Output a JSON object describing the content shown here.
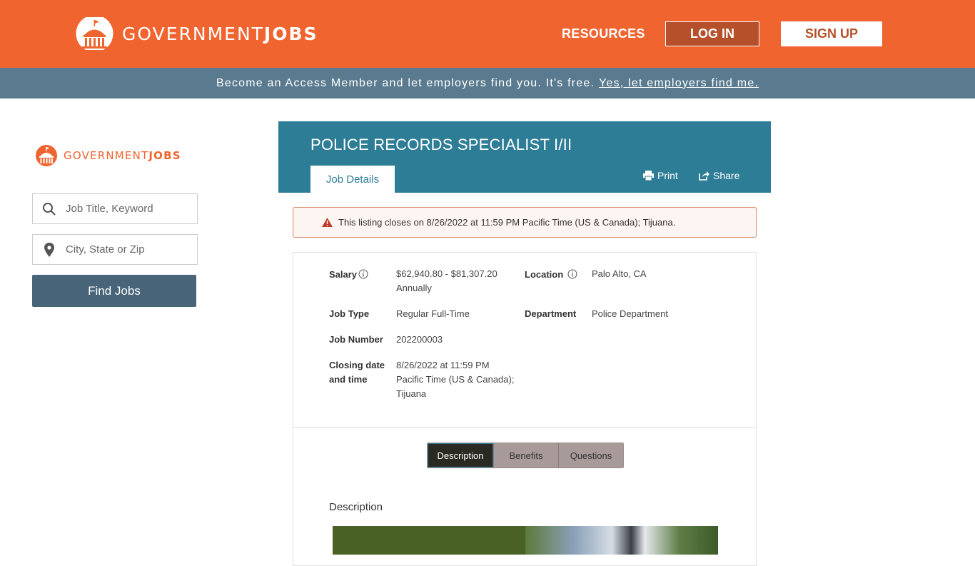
{
  "header": {
    "brand_main": "GOVERNMENT",
    "brand_bold": "JOBS",
    "resources": "RESOURCES",
    "login": "LOG IN",
    "signup": "SIGN UP",
    "color": "#f0642f"
  },
  "access_bar": {
    "text": "Become an Access Member and let employers find you. It's free.",
    "link": "Yes, let employers find me."
  },
  "sidebar": {
    "brand_main": "GOVERNMENT",
    "brand_bold": "JOBS",
    "keyword_placeholder": "Job Title, Keyword",
    "location_placeholder": "City, State or Zip",
    "find_button": "Find Jobs"
  },
  "job": {
    "title": "POLICE RECORDS SPECIALIST I/II",
    "tab": "Job Details",
    "print": "Print",
    "share": "Share",
    "alert": "This listing closes on 8/26/2022 at 11:59 PM Pacific Time (US & Canada); Tijuana.",
    "fields": {
      "salary_label": "Salary",
      "salary_line1": "$62,940.80 - $81,307.20",
      "salary_line2": "Annually",
      "location_label": "Location",
      "location_value": "Palo Alto, CA",
      "job_type_label": "Job Type",
      "job_type_value": "Regular Full-Time",
      "department_label": "Department",
      "department_value": "Police Department",
      "job_number_label": "Job Number",
      "job_number_value": "202200003",
      "closing_label_1": "Closing date",
      "closing_label_2": "and time",
      "closing_line1": "8/26/2022 at 11:59 PM",
      "closing_line2": "Pacific Time (US & Canada);",
      "closing_line3": "Tijuana"
    },
    "tabs": [
      "Description",
      "Benefits",
      "Questions"
    ],
    "description_heading": "Description"
  }
}
